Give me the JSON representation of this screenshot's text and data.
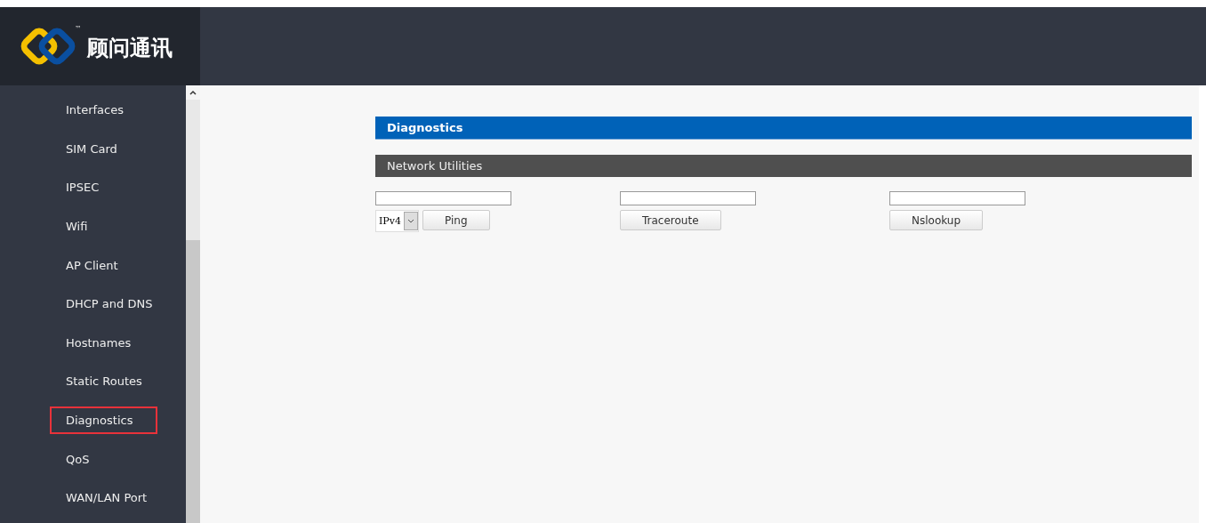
{
  "logo": {
    "name": "顾问通讯",
    "trademark": "™"
  },
  "sidebar": {
    "items": [
      {
        "label": "Interfaces",
        "selected": false
      },
      {
        "label": "SIM Card",
        "selected": false
      },
      {
        "label": "IPSEC",
        "selected": false
      },
      {
        "label": "Wifi",
        "selected": false
      },
      {
        "label": "AP Client",
        "selected": false
      },
      {
        "label": "DHCP and DNS",
        "selected": false
      },
      {
        "label": "Hostnames",
        "selected": false
      },
      {
        "label": "Static Routes",
        "selected": false
      },
      {
        "label": "Diagnostics",
        "selected": true
      },
      {
        "label": "QoS",
        "selected": false
      },
      {
        "label": "WAN/LAN Port",
        "selected": false
      }
    ]
  },
  "page": {
    "title": "Diagnostics",
    "section": "Network Utilities",
    "tools": [
      {
        "kind": "ping",
        "protocol": "IPv4",
        "button": "Ping"
      },
      {
        "kind": "plain",
        "button": "Traceroute"
      },
      {
        "kind": "plain",
        "button": "Nslookup"
      }
    ]
  }
}
